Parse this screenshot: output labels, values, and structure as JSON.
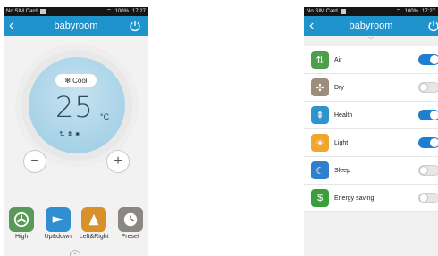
{
  "status_left": {
    "carrier": "No SIM Card"
  },
  "status_right": {
    "battery": "100%",
    "time": "17:27"
  },
  "main_screen": {
    "title": "babyroom",
    "mode_label": "Cool",
    "temperature": "25",
    "unit": "°C",
    "minus_label": "−",
    "plus_label": "+",
    "menu": [
      {
        "label": "High",
        "icon": "fan-icon",
        "color": "#5a9a58"
      },
      {
        "label": "Up&down",
        "icon": "swing-vertical-icon",
        "color": "#2f8fd0"
      },
      {
        "label": "Left&Right",
        "icon": "swing-horizontal-icon",
        "color": "#d8902a"
      },
      {
        "label": "Preset",
        "icon": "clock-icon",
        "color": "#8b8782"
      }
    ]
  },
  "function_screen": {
    "title": "babyroom",
    "items": [
      {
        "label": "Air",
        "icon": "air-icon",
        "color": "#4da04b",
        "on": true
      },
      {
        "label": "Dry",
        "icon": "dry-icon",
        "color": "#9b8d7a",
        "on": false
      },
      {
        "label": "Health",
        "icon": "health-icon",
        "color": "#2f93cf",
        "on": true
      },
      {
        "label": "Light",
        "icon": "light-icon",
        "color": "#f0a62a",
        "on": true
      },
      {
        "label": "Sleep",
        "icon": "sleep-icon",
        "color": "#2f7fcc",
        "on": false
      },
      {
        "label": "Energy saving",
        "icon": "energy-saving-icon",
        "color": "#3b9e3c",
        "on": false
      }
    ]
  },
  "colors": {
    "accent": "#1e93cc",
    "toggle_on": "#1e7fd0"
  }
}
